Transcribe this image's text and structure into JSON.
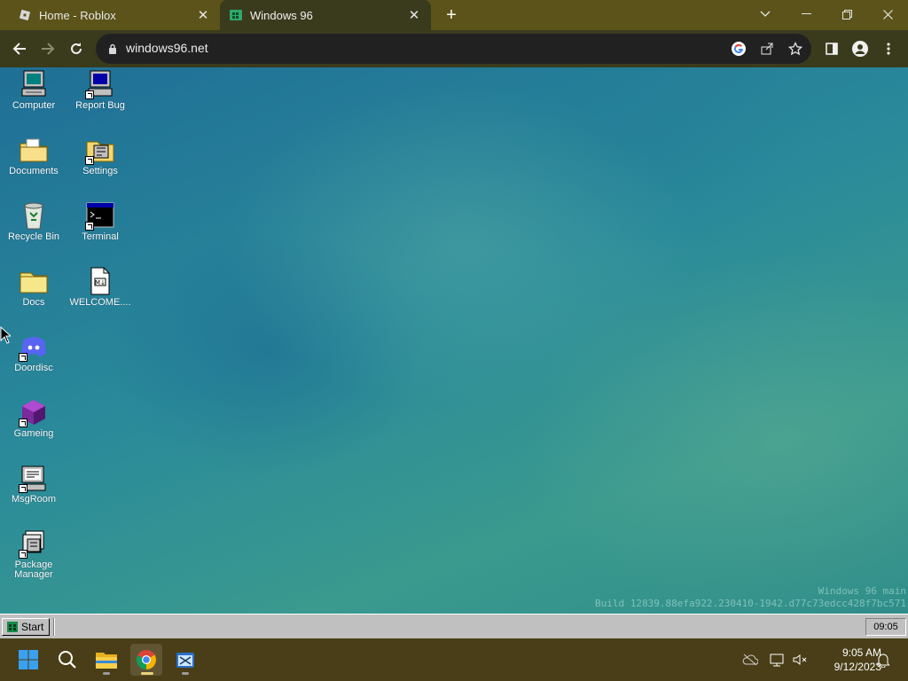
{
  "browser": {
    "tabs": [
      {
        "title": "Home - Roblox",
        "active": false
      },
      {
        "title": "Windows 96",
        "active": true
      }
    ],
    "address": "windows96.net"
  },
  "desktop": {
    "icons": [
      {
        "label": "Computer",
        "icon": "computer-icon"
      },
      {
        "label": "Report Bug",
        "icon": "report-bug-icon"
      },
      {
        "label": "Documents",
        "icon": "documents-folder-icon"
      },
      {
        "label": "Settings",
        "icon": "settings-folder-icon"
      },
      {
        "label": "Recycle Bin",
        "icon": "recycle-bin-icon"
      },
      {
        "label": "Terminal",
        "icon": "terminal-icon"
      },
      {
        "label": "Docs",
        "icon": "folder-icon"
      },
      {
        "label": "WELCOME....",
        "icon": "markdown-file-icon"
      },
      {
        "label": "Doordisc",
        "icon": "discord-icon"
      },
      {
        "label": "Gameing",
        "icon": "purple-cube-icon"
      },
      {
        "label": "MsgRoom",
        "icon": "msgroom-icon"
      },
      {
        "label": "Package Manager",
        "icon": "package-manager-icon"
      }
    ],
    "build_line1": "Windows 96 main",
    "build_line2": "Build 12839.88efa922.230410-1942.d77c73edcc428f7bc571"
  },
  "w96_taskbar": {
    "start_label": "Start",
    "clock": "09:05"
  },
  "os_taskbar": {
    "time": "9:05 AM",
    "date": "9/12/2023"
  },
  "colors": {
    "desktop_teal": "#2a8a9a",
    "browser_frame": "#5b5319",
    "os_taskbar": "#493e17",
    "w96_gray": "#c0c0c0"
  }
}
